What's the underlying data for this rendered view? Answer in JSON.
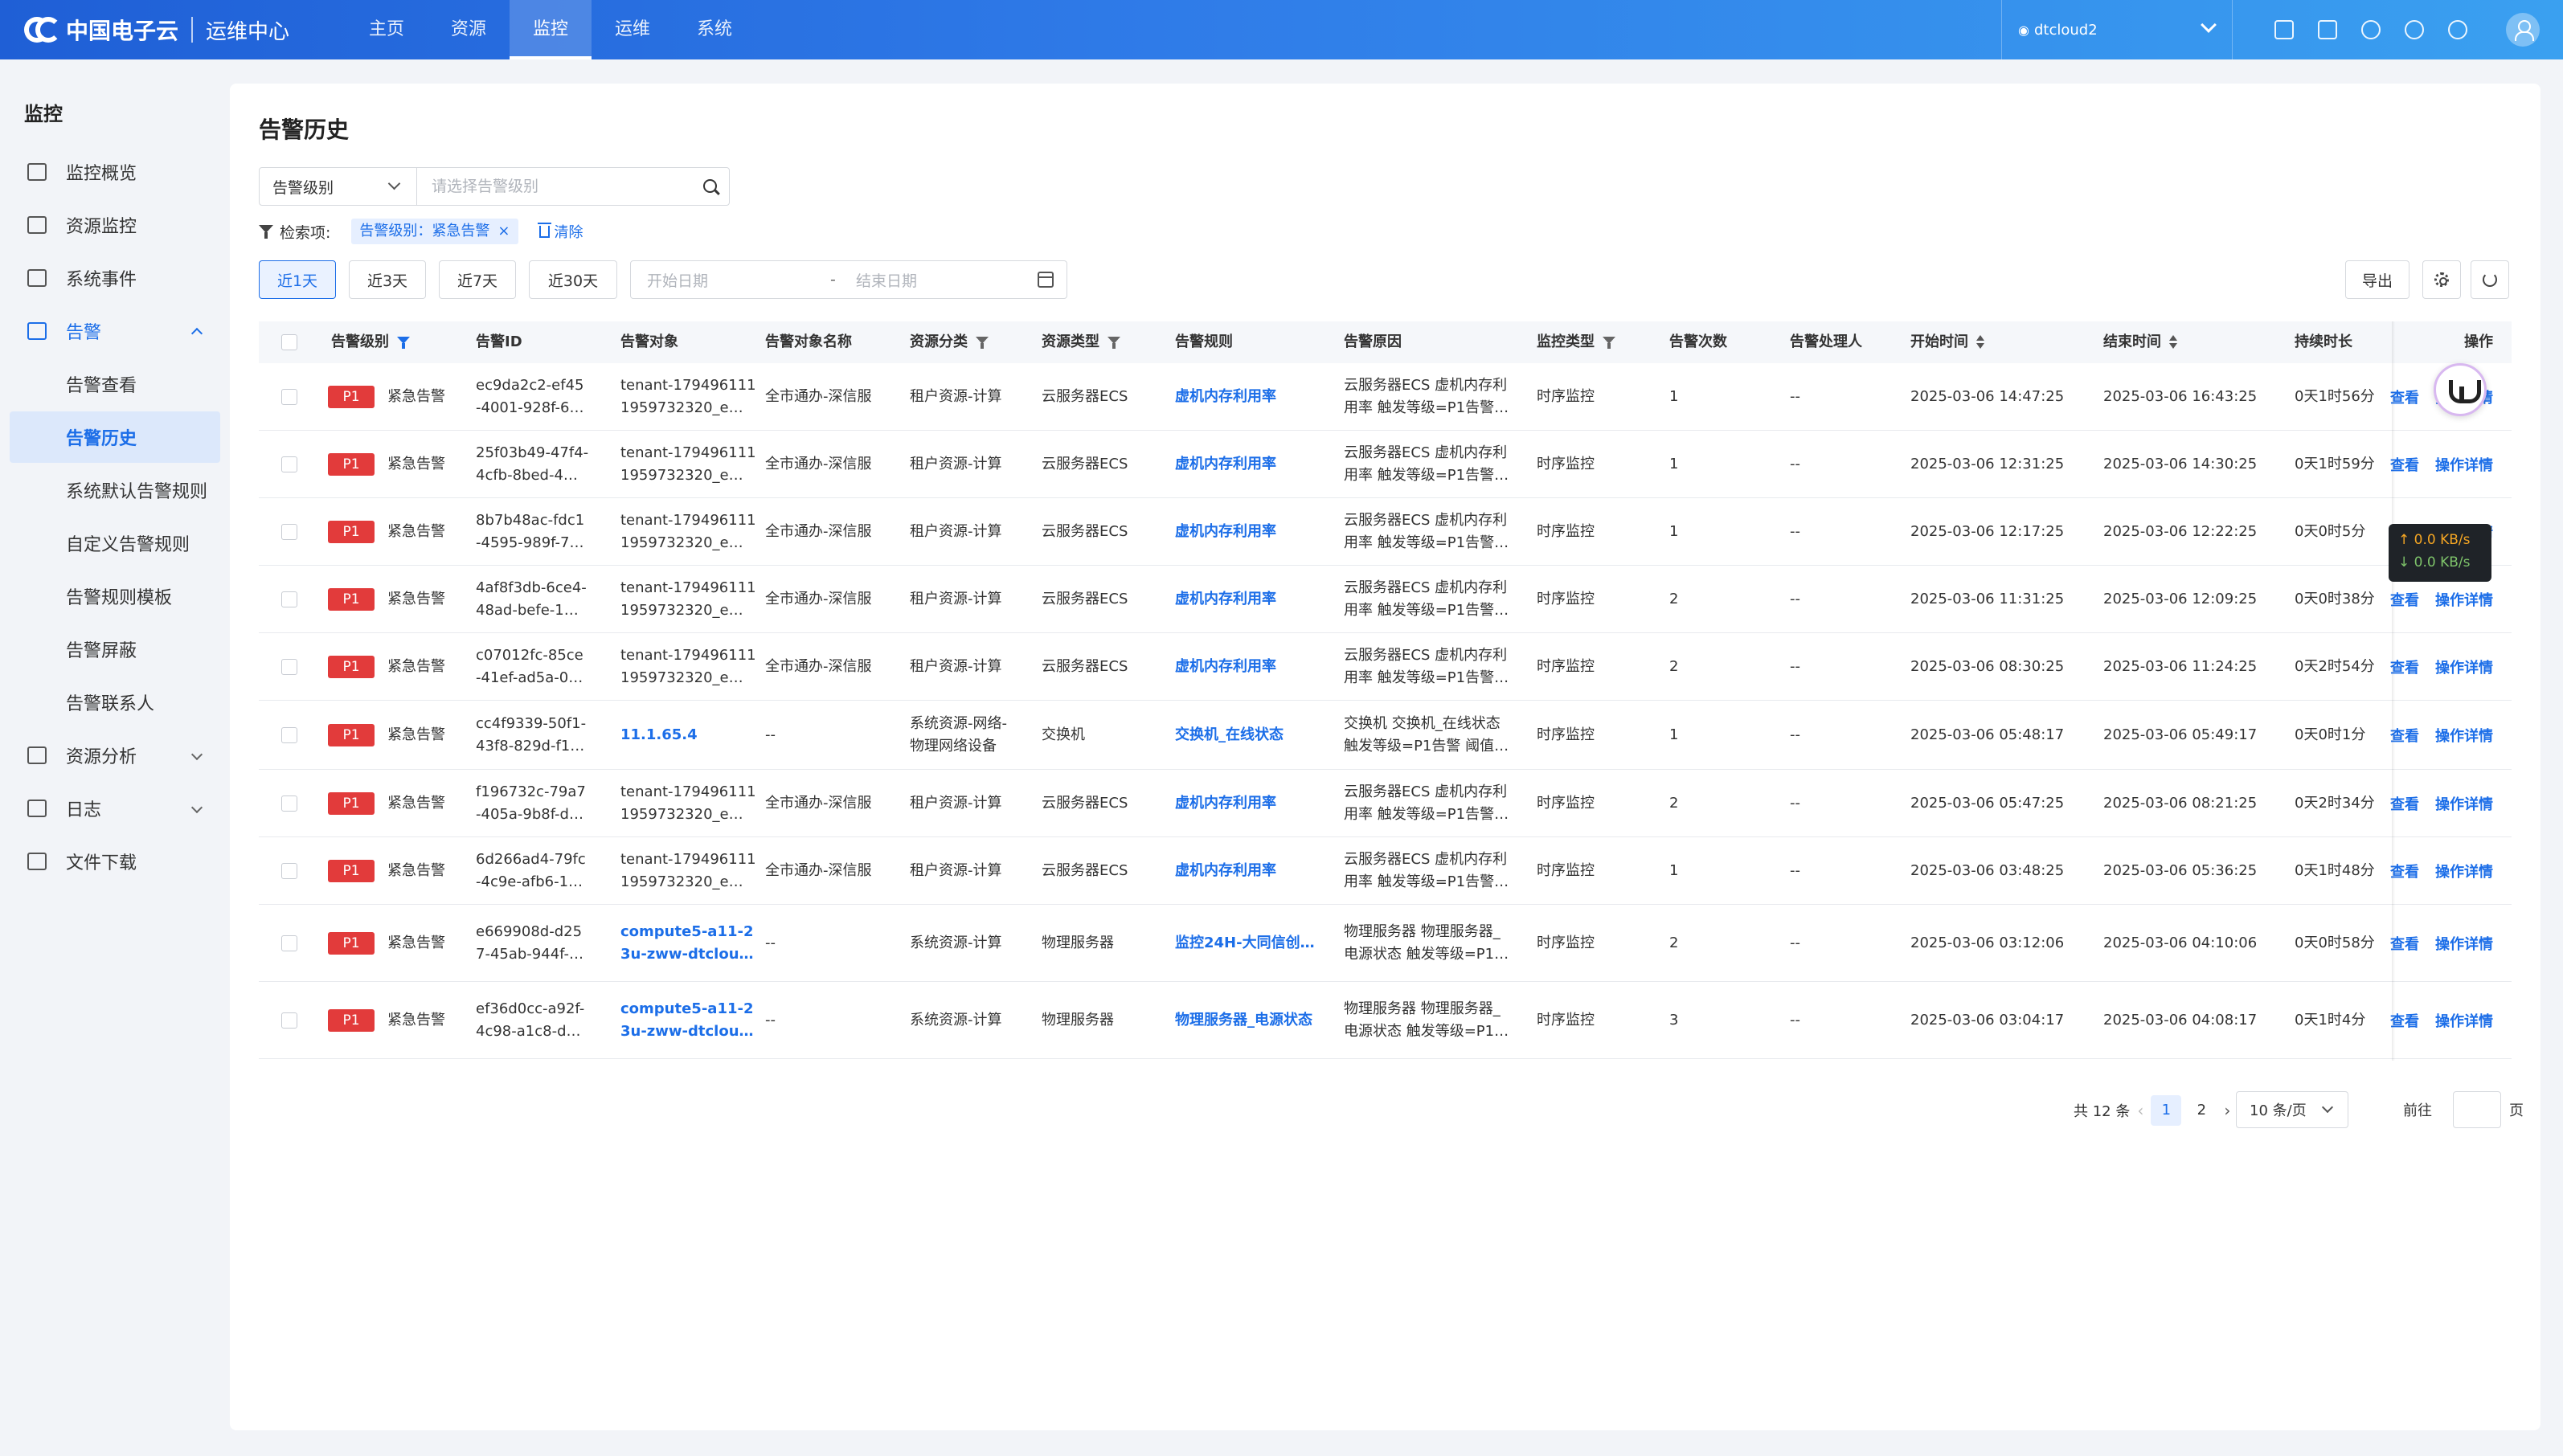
{
  "header": {
    "brand": "中国电子云",
    "subtitle": "运维中心",
    "nav": [
      "主页",
      "资源",
      "监控",
      "运维",
      "系统"
    ],
    "active_nav": 2,
    "region": "dtcloud2"
  },
  "sidebar": {
    "title": "监控",
    "items": [
      {
        "label": "监控概览",
        "icon": "grid-icon"
      },
      {
        "label": "资源监控",
        "icon": "monitor-icon"
      },
      {
        "label": "系统事件",
        "icon": "calendar-icon"
      },
      {
        "label": "告警",
        "icon": "alarm-icon"
      },
      {
        "label": "告警查看"
      },
      {
        "label": "告警历史"
      },
      {
        "label": "系统默认告警规则"
      },
      {
        "label": "自定义告警规则"
      },
      {
        "label": "告警规则模板"
      },
      {
        "label": "告警屏蔽"
      },
      {
        "label": "告警联系人"
      },
      {
        "label": "资源分析",
        "icon": "chart-icon"
      },
      {
        "label": "日志",
        "icon": "log-icon"
      },
      {
        "label": "文件下载",
        "icon": "download-icon"
      }
    ]
  },
  "main": {
    "title": "告警历史",
    "search": {
      "select_value": "告警级别",
      "placeholder": "请选择告警级别"
    },
    "filter": {
      "label": "检索项:",
      "tag": "告警级别：紧急告警",
      "clear": "清除"
    },
    "quick": [
      "近1天",
      "近3天",
      "近7天",
      "近30天"
    ],
    "date": {
      "start": "开始日期",
      "end": "结束日期",
      "sep": "-"
    },
    "export": "导出"
  },
  "table": {
    "headers": [
      "告警级别",
      "告警ID",
      "告警对象",
      "告警对象名称",
      "资源分类",
      "资源类型",
      "告警规则",
      "告警原因",
      "监控类型",
      "告警次数",
      "告警处理人",
      "开始时间",
      "结束时间",
      "持续时长",
      "操作"
    ],
    "actions": {
      "view": "查看",
      "detail": "操作详情"
    },
    "rows": [
      {
        "level": "P1",
        "level_text": "紧急告警",
        "id1": "ec9da2c2-ef45",
        "id2": "-4001-928f-6…",
        "obj1": "tenant-179496111",
        "obj2": "1959732320_e…",
        "obj_link": false,
        "name": "全市通办-深信服",
        "cat1": "租户资源-计算",
        "cat2": "",
        "type": "云服务器ECS",
        "rule": "虚机内存利用率",
        "reason1": "云服务器ECS 虚机内存利",
        "reason2": "用率 触发等级=P1告警…",
        "mon": "时序监控",
        "count": "1",
        "handler": "--",
        "start": "2025-03-06 14:47:25",
        "end": "2025-03-06 16:43:25",
        "dur": "0天1时56分"
      },
      {
        "level": "P1",
        "level_text": "紧急告警",
        "id1": "25f03b49-47f4-",
        "id2": "4cfb-8bed-4…",
        "obj1": "tenant-179496111",
        "obj2": "1959732320_e…",
        "obj_link": false,
        "name": "全市通办-深信服",
        "cat1": "租户资源-计算",
        "cat2": "",
        "type": "云服务器ECS",
        "rule": "虚机内存利用率",
        "reason1": "云服务器ECS 虚机内存利",
        "reason2": "用率 触发等级=P1告警…",
        "mon": "时序监控",
        "count": "1",
        "handler": "--",
        "start": "2025-03-06 12:31:25",
        "end": "2025-03-06 14:30:25",
        "dur": "0天1时59分"
      },
      {
        "level": "P1",
        "level_text": "紧急告警",
        "id1": "8b7b48ac-fdc1",
        "id2": "-4595-989f-7…",
        "obj1": "tenant-179496111",
        "obj2": "1959732320_e…",
        "obj_link": false,
        "name": "全市通办-深信服",
        "cat1": "租户资源-计算",
        "cat2": "",
        "type": "云服务器ECS",
        "rule": "虚机内存利用率",
        "reason1": "云服务器ECS 虚机内存利",
        "reason2": "用率 触发等级=P1告警…",
        "mon": "时序监控",
        "count": "1",
        "handler": "--",
        "start": "2025-03-06 12:17:25",
        "end": "2025-03-06 12:22:25",
        "dur": "0天0时5分"
      },
      {
        "level": "P1",
        "level_text": "紧急告警",
        "id1": "4af8f3db-6ce4-",
        "id2": "48ad-befe-1…",
        "obj1": "tenant-179496111",
        "obj2": "1959732320_e…",
        "obj_link": false,
        "name": "全市通办-深信服",
        "cat1": "租户资源-计算",
        "cat2": "",
        "type": "云服务器ECS",
        "rule": "虚机内存利用率",
        "reason1": "云服务器ECS 虚机内存利",
        "reason2": "用率 触发等级=P1告警…",
        "mon": "时序监控",
        "count": "2",
        "handler": "--",
        "start": "2025-03-06 11:31:25",
        "end": "2025-03-06 12:09:25",
        "dur": "0天0时38分"
      },
      {
        "level": "P1",
        "level_text": "紧急告警",
        "id1": "c07012fc-85ce",
        "id2": "-41ef-ad5a-0…",
        "obj1": "tenant-179496111",
        "obj2": "1959732320_e…",
        "obj_link": false,
        "name": "全市通办-深信服",
        "cat1": "租户资源-计算",
        "cat2": "",
        "type": "云服务器ECS",
        "rule": "虚机内存利用率",
        "reason1": "云服务器ECS 虚机内存利",
        "reason2": "用率 触发等级=P1告警…",
        "mon": "时序监控",
        "count": "2",
        "handler": "--",
        "start": "2025-03-06 08:30:25",
        "end": "2025-03-06 11:24:25",
        "dur": "0天2时54分"
      },
      {
        "level": "P1",
        "level_text": "紧急告警",
        "id1": "cc4f9339-50f1-",
        "id2": "43f8-829d-f1…",
        "obj1": "11.1.65.4",
        "obj2": "",
        "obj_link": true,
        "name": "--",
        "cat1": "系统资源-网络-",
        "cat2": "物理网络设备",
        "type": "交换机",
        "rule": "交换机_在线状态",
        "reason1": "交换机 交换机_在线状态",
        "reason2": "触发等级=P1告警 阈值…",
        "mon": "时序监控",
        "count": "1",
        "handler": "--",
        "start": "2025-03-06 05:48:17",
        "end": "2025-03-06 05:49:17",
        "dur": "0天0时1分"
      },
      {
        "level": "P1",
        "level_text": "紧急告警",
        "id1": "f196732c-79a7",
        "id2": "-405a-9b8f-d…",
        "obj1": "tenant-179496111",
        "obj2": "1959732320_e…",
        "obj_link": false,
        "name": "全市通办-深信服",
        "cat1": "租户资源-计算",
        "cat2": "",
        "type": "云服务器ECS",
        "rule": "虚机内存利用率",
        "reason1": "云服务器ECS 虚机内存利",
        "reason2": "用率 触发等级=P1告警…",
        "mon": "时序监控",
        "count": "2",
        "handler": "--",
        "start": "2025-03-06 05:47:25",
        "end": "2025-03-06 08:21:25",
        "dur": "0天2时34分"
      },
      {
        "level": "P1",
        "level_text": "紧急告警",
        "id1": "6d266ad4-79fc",
        "id2": "-4c9e-afb6-1…",
        "obj1": "tenant-179496111",
        "obj2": "1959732320_e…",
        "obj_link": false,
        "name": "全市通办-深信服",
        "cat1": "租户资源-计算",
        "cat2": "",
        "type": "云服务器ECS",
        "rule": "虚机内存利用率",
        "reason1": "云服务器ECS 虚机内存利",
        "reason2": "用率 触发等级=P1告警…",
        "mon": "时序监控",
        "count": "1",
        "handler": "--",
        "start": "2025-03-06 03:48:25",
        "end": "2025-03-06 05:36:25",
        "dur": "0天1时48分"
      },
      {
        "level": "P1",
        "level_text": "紧急告警",
        "id1": "e669908d-d25",
        "id2": "7-45ab-944f-…",
        "obj1": "compute5-a11-2",
        "obj2": "3u-zww-dtclou…",
        "obj_link": true,
        "name": "--",
        "cat1": "系统资源-计算",
        "cat2": "",
        "type": "物理服务器",
        "rule": "监控24H-大同信创…",
        "reason1": "物理服务器 物理服务器_",
        "reason2": "电源状态 触发等级=P1…",
        "mon": "时序监控",
        "count": "2",
        "handler": "--",
        "start": "2025-03-06 03:12:06",
        "end": "2025-03-06 04:10:06",
        "dur": "0天0时58分"
      },
      {
        "level": "P1",
        "level_text": "紧急告警",
        "id1": "ef36d0cc-a92f-",
        "id2": "4c98-a1c8-d…",
        "obj1": "compute5-a11-2",
        "obj2": "3u-zww-dtclou…",
        "obj_link": true,
        "name": "--",
        "cat1": "系统资源-计算",
        "cat2": "",
        "type": "物理服务器",
        "rule": "物理服务器_电源状态",
        "reason1": "物理服务器 物理服务器_",
        "reason2": "电源状态 触发等级=P1…",
        "mon": "时序监控",
        "count": "3",
        "handler": "--",
        "start": "2025-03-06 03:04:17",
        "end": "2025-03-06 04:08:17",
        "dur": "0天1时4分"
      }
    ]
  },
  "pagination": {
    "total": "共 12 条",
    "pages": [
      "1",
      "2"
    ],
    "current": "1",
    "size": "10 条/页",
    "goto_label": "前往",
    "page_suffix": "页"
  },
  "netspeed": {
    "up": "↑ 0.0 KB/s",
    "down": "↓ 0.0 KB/s"
  },
  "colors": {
    "primary": "#1c6ee8",
    "danger": "#e23b3b"
  }
}
